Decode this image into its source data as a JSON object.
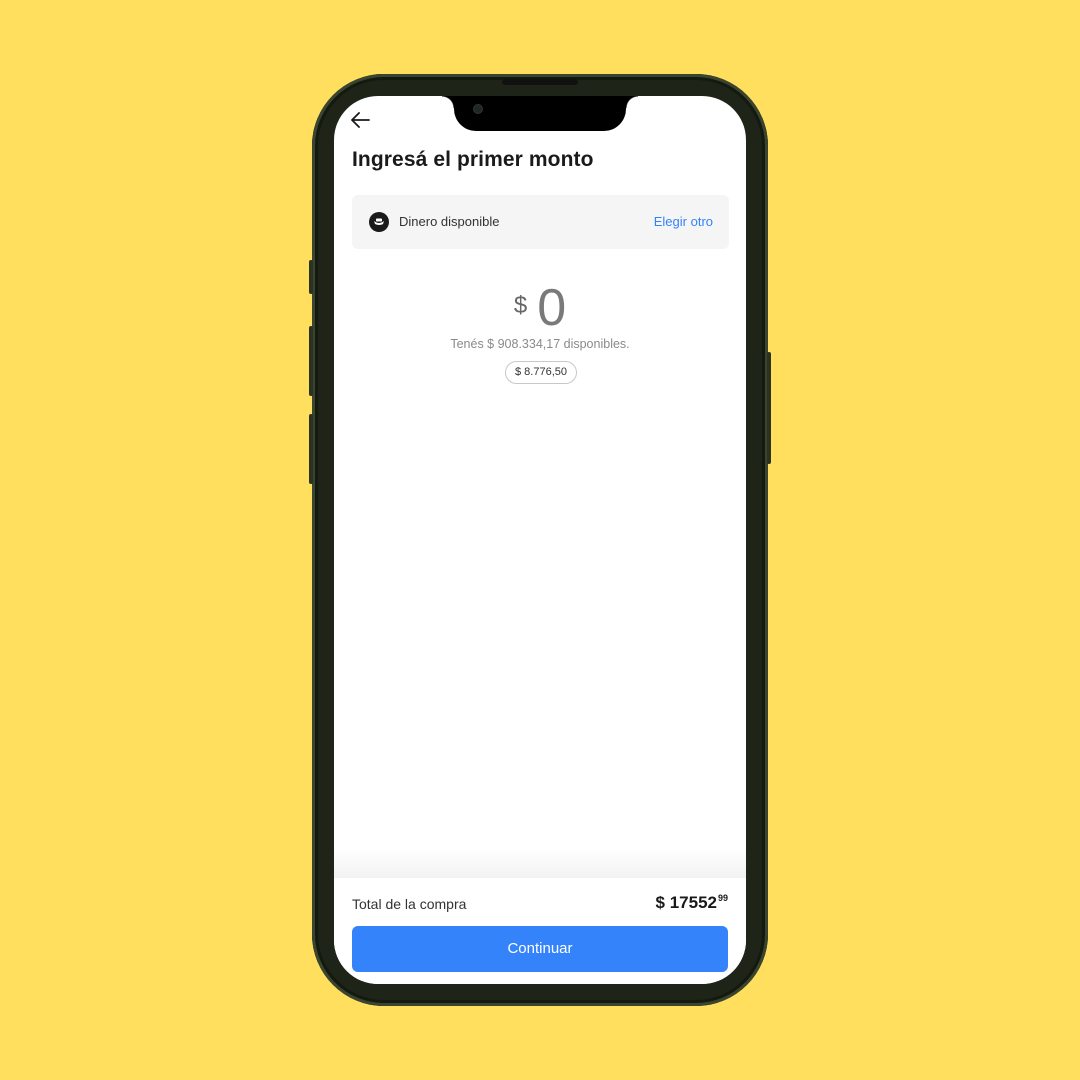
{
  "header": {
    "back_icon": "arrow-left-icon",
    "title": "Ingresá el primer monto"
  },
  "payment_source": {
    "icon": "money-hand-icon",
    "label": "Dinero disponible",
    "change_label": "Elegir otro"
  },
  "amount": {
    "currency": "$",
    "value": "0",
    "available_text": "Tenés $ 908.334,17 disponibles.",
    "suggestion_chip": "$ 8.776,50"
  },
  "footer": {
    "total_label": "Total de la compra",
    "total_currency": "$",
    "total_integer": "17552",
    "total_cents": "99",
    "continue_label": "Continuar"
  },
  "colors": {
    "background": "#FFDF5D",
    "accent": "#3483fa"
  }
}
